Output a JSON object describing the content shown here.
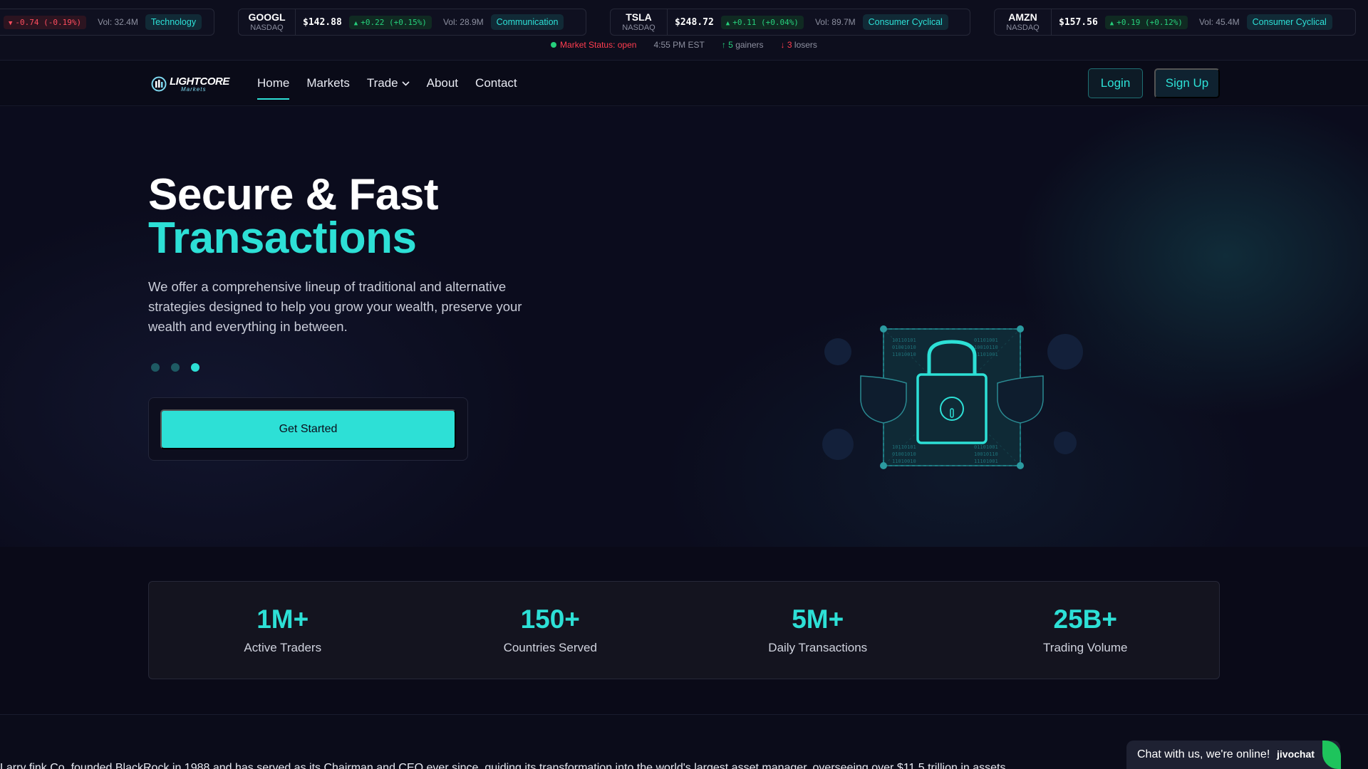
{
  "ticker": {
    "cards": [
      {
        "symbol": "",
        "exchange": "",
        "price": "",
        "change": "-0.74 (-0.19%)",
        "direction": "down",
        "volume": "Vol: 32.4M",
        "sector": "Technology"
      },
      {
        "symbol": "GOOGL",
        "exchange": "NASDAQ",
        "price": "$142.88",
        "change": "+0.22 (+0.15%)",
        "direction": "up",
        "volume": "Vol: 28.9M",
        "sector": "Communication"
      },
      {
        "symbol": "TSLA",
        "exchange": "NASDAQ",
        "price": "$248.72",
        "change": "+0.11 (+0.04%)",
        "direction": "up",
        "volume": "Vol: 89.7M",
        "sector": "Consumer Cyclical"
      },
      {
        "symbol": "AMZN",
        "exchange": "NASDAQ",
        "price": "$157.56",
        "change": "+0.19 (+0.12%)",
        "direction": "up",
        "volume": "Vol: 45.4M",
        "sector": "Consumer Cyclical"
      }
    ],
    "status": {
      "market_label": "Market Status: open",
      "time": "4:55 PM EST",
      "gainers_count": "5",
      "gainers_label": "gainers",
      "losers_count": "3",
      "losers_label": "losers"
    }
  },
  "nav": {
    "logo_text": "LIGHTCORE",
    "logo_sub": "Markets",
    "links": [
      "Home",
      "Markets",
      "Trade",
      "About",
      "Contact"
    ],
    "login": "Login",
    "signup": "Sign Up"
  },
  "hero": {
    "title_line1": "Secure & Fast",
    "title_line2": "Transactions",
    "description": "We offer a comprehensive lineup of traditional and alternative strategies designed to help you grow your wealth, preserve your wealth and everything in between.",
    "active_slide": 3,
    "slide_count": 3,
    "cta": "Get Started"
  },
  "stats": [
    {
      "value": "1M+",
      "label": "Active Traders"
    },
    {
      "value": "150+",
      "label": "Countries Served"
    },
    {
      "value": "5M+",
      "label": "Daily Transactions"
    },
    {
      "value": "25B+",
      "label": "Trading Volume"
    }
  ],
  "bottom_text": "Larry fink Co. founded BlackRock in 1988 and has served as its Chairman and CEO ever since, guiding its transformation into the world's largest asset manager, overseeing over $11.5 trillion in assets.",
  "chat": {
    "message": "Chat with us, we're online!",
    "brand": "jivochat"
  },
  "colors": {
    "accent": "#2de0d6",
    "background": "#0b0c1a",
    "up": "#26d07c",
    "down": "#ff4d5e"
  }
}
